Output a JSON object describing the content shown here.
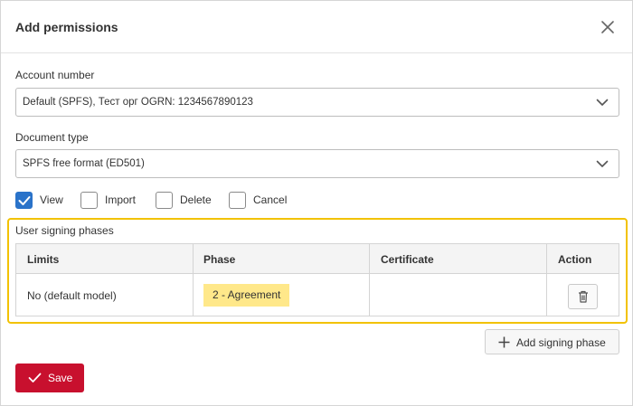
{
  "dialog": {
    "title": "Add permissions"
  },
  "account": {
    "label": "Account number",
    "value": "Default (SPFS), Тест орг OGRN: 1234567890123"
  },
  "document_type": {
    "label": "Document type",
    "value": "SPFS free format (ED501)"
  },
  "permissions": [
    {
      "label": "View",
      "checked": true
    },
    {
      "label": "Import",
      "checked": false
    },
    {
      "label": "Delete",
      "checked": false
    },
    {
      "label": "Cancel",
      "checked": false
    }
  ],
  "phases": {
    "title": "User signing phases",
    "columns": [
      "Limits",
      "Phase",
      "Certificate",
      "Action"
    ],
    "rows": [
      {
        "limits": "No (default model)",
        "phase": "2 - Agreement",
        "certificate": ""
      }
    ],
    "highlight_color": "#f2c200"
  },
  "buttons": {
    "add_phase": "Add signing phase",
    "save": "Save"
  },
  "colors": {
    "accent": "#2a73c9",
    "save": "#c8102e",
    "phase_chip": "#ffe88a"
  }
}
